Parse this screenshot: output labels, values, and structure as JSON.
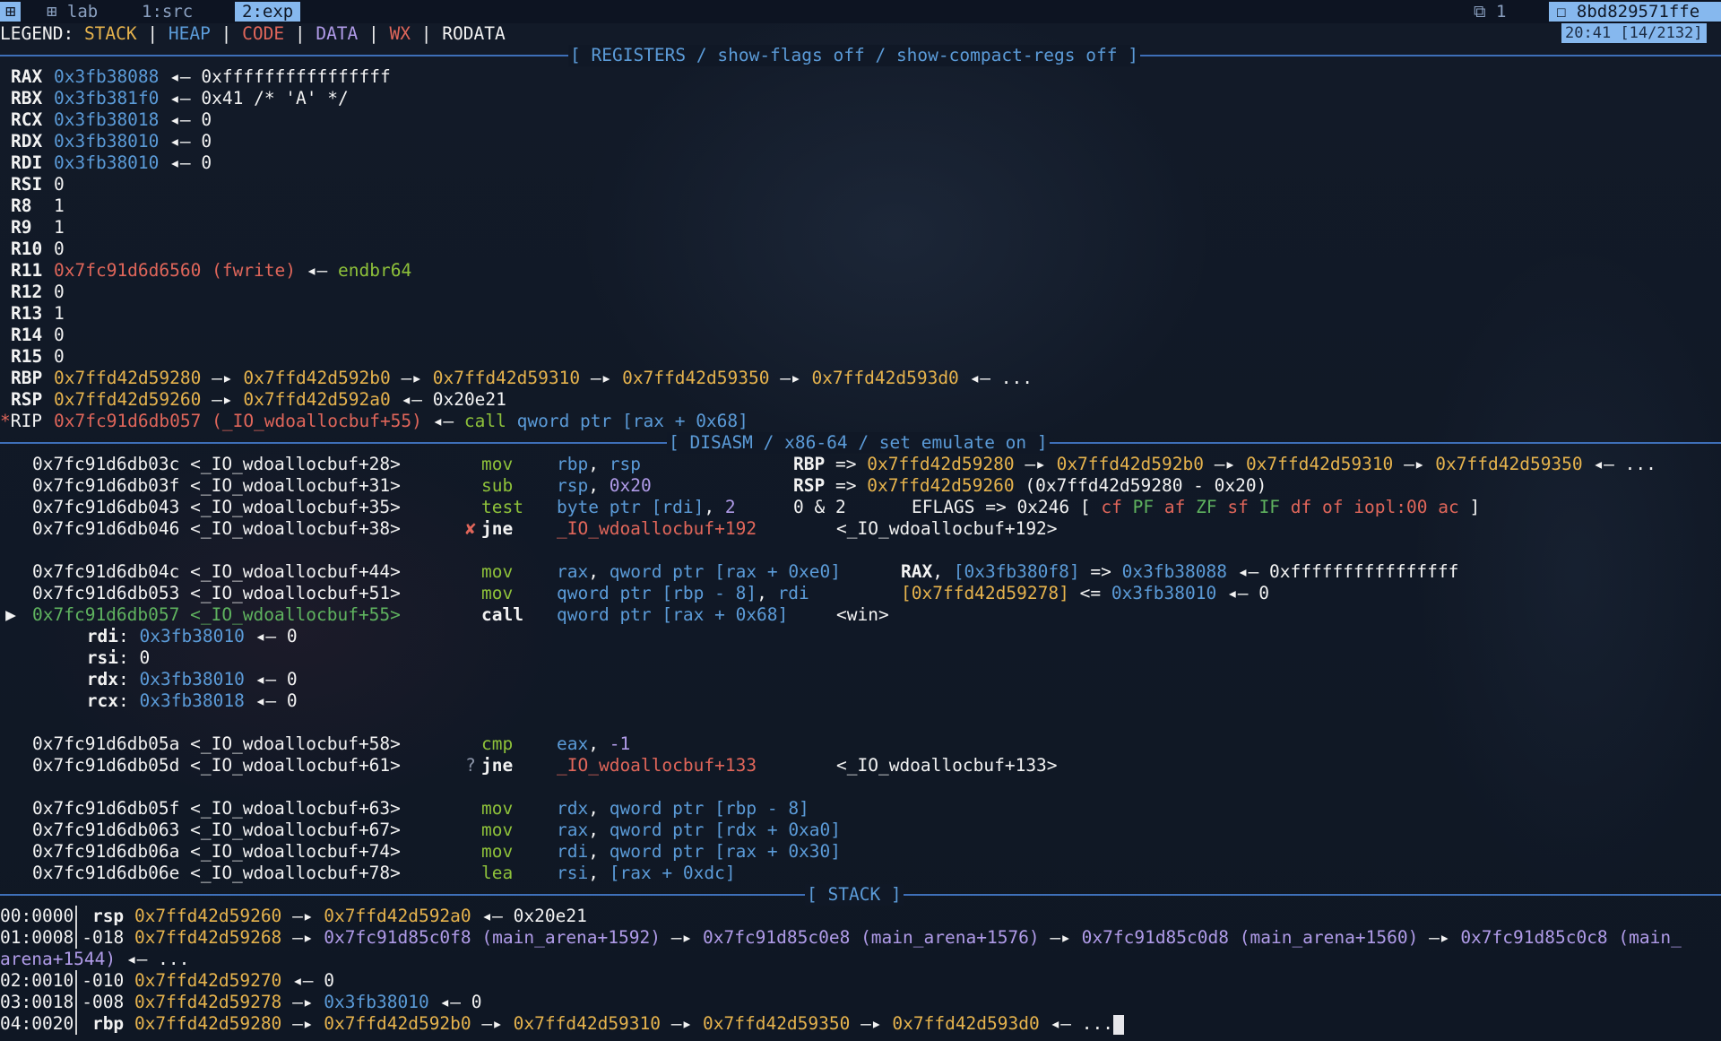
{
  "topbar": {
    "session_icon": "⊞",
    "window_icon": "⊞",
    "tab_lab": "lab",
    "tab_src": "1:src",
    "tab_exp": "2:exp",
    "client_icon": "⧉",
    "client_count": "1",
    "host_icon": "☐",
    "host": "8bd829571ffe",
    "clock": "20:41 [14/2132]"
  },
  "legend": {
    "prefix": "LEGEND:",
    "stack": "STACK",
    "heap": "HEAP",
    "code": "CODE",
    "data": "DATA",
    "wx": "WX",
    "rodata": "RODATA",
    "pipe": "|"
  },
  "headers": {
    "registers": "[ REGISTERS / show-flags off / show-compact-regs off ]",
    "disasm": "[ DISASM / x86-64 / set emulate on ]",
    "stack": "[ STACK ]"
  },
  "registers": {
    "rax": {
      "name": "RAX",
      "a": "0x3fb38088",
      "b": "0xffffffffffffffff"
    },
    "rbx": {
      "name": "RBX",
      "a": "0x3fb381f0",
      "b": "0x41 /* 'A' */"
    },
    "rcx": {
      "name": "RCX",
      "a": "0x3fb38018",
      "b": "0"
    },
    "rdx": {
      "name": "RDX",
      "a": "0x3fb38010",
      "b": "0"
    },
    "rdi": {
      "name": "RDI",
      "a": "0x3fb38010",
      "b": "0"
    },
    "rsi": {
      "name": "RSI",
      "v": "0"
    },
    "r8": {
      "name": "R8",
      "v": "1"
    },
    "r9": {
      "name": "R9",
      "v": "1"
    },
    "r10": {
      "name": "R10",
      "v": "0"
    },
    "r11": {
      "name": "R11",
      "a": "0x7fc91d6d6560 (fwrite)",
      "b": "endbr64"
    },
    "r12": {
      "name": "R12",
      "v": "0"
    },
    "r13": {
      "name": "R13",
      "v": "1"
    },
    "r14": {
      "name": "R14",
      "v": "0"
    },
    "r15": {
      "name": "R15",
      "v": "0"
    },
    "rbp": {
      "name": "RBP",
      "a": "0x7ffd42d59280",
      "b": "0x7ffd42d592b0",
      "c": "0x7ffd42d59310",
      "d": "0x7ffd42d59350",
      "e": "0x7ffd42d593d0",
      "tail": "..."
    },
    "rsp": {
      "name": "RSP",
      "a": "0x7ffd42d59260",
      "b": "0x7ffd42d592a0",
      "c": "0x20e21"
    },
    "rip": {
      "star": "*",
      "name": "RIP",
      "a": "0x7fc91d6db057 (_IO_wdoallocbuf+55)",
      "b": "call",
      "c": "qword ptr [rax + 0x68]"
    }
  },
  "disasm": {
    "l1": {
      "addr": "0x7fc91d6db03c <_IO_wdoallocbuf+28>",
      "mn": "mov",
      "op1": "rbp",
      "op2": "rsp",
      "k": "RBP",
      "v1": "0x7ffd42d59280",
      "v2": "0x7ffd42d592b0",
      "v3": "0x7ffd42d59310",
      "v4": "0x7ffd42d59350",
      "tail": "..."
    },
    "l2": {
      "addr": "0x7fc91d6db03f <_IO_wdoallocbuf+31>",
      "mn": "sub",
      "op1": "rsp",
      "op2": "0x20",
      "k": "RSP",
      "v1": "0x7ffd42d59260",
      "v2": "(0x7ffd42d59280 - 0x20)"
    },
    "l3": {
      "addr": "0x7fc91d6db043 <_IO_wdoallocbuf+35>",
      "mn": "test",
      "op1": "byte ptr [rdi]",
      "op2": "2",
      "c1": "0 & 2",
      "k": "EFLAGS",
      "v1": "0x246",
      "fl_open": "[",
      "fl_cf": "cf",
      "fl_pf": "PF",
      "fl_af": "af",
      "fl_zf": "ZF",
      "fl_sf": "sf",
      "fl_if": "IF",
      "fl_df": "df",
      "fl_of": "of",
      "fl_iopl": "iopl:00",
      "fl_ac": "ac",
      "fl_close": "]"
    },
    "l4": {
      "addr": "0x7fc91d6db046 <_IO_wdoallocbuf+38>",
      "mark": "✘",
      "mn": "jne",
      "op": "_IO_wdoallocbuf+192",
      "target": "<_IO_wdoallocbuf+192>"
    },
    "l5": {
      "addr": "0x7fc91d6db04c <_IO_wdoallocbuf+44>",
      "mn": "mov",
      "op1": "rax",
      "op2": "qword ptr [rax + 0xe0]",
      "k": "RAX",
      "v0": "[0x3fb380f8]",
      "v1": "0x3fb38088",
      "v2": "0xffffffffffffffff"
    },
    "l6": {
      "addr": "0x7fc91d6db053 <_IO_wdoallocbuf+51>",
      "mn": "mov",
      "op1": "qword ptr [rbp - 8]",
      "op2": "rdi",
      "v0": "[0x7ffd42d59278]",
      "v1": "0x3fb38010",
      "v2": "0"
    },
    "l7": {
      "arrow": "▶",
      "addr": "0x7fc91d6db057 <_IO_wdoallocbuf+55>",
      "mn": "call",
      "op": "qword ptr [rax + 0x68]",
      "target": "<win>"
    },
    "args": [
      {
        "name": "rdi",
        "a": "0x3fb38010",
        "b": "0"
      },
      {
        "name": "rsi",
        "v": "0"
      },
      {
        "name": "rdx",
        "a": "0x3fb38010",
        "b": "0"
      },
      {
        "name": "rcx",
        "a": "0x3fb38018",
        "b": "0"
      }
    ],
    "l8": {
      "addr": "0x7fc91d6db05a <_IO_wdoallocbuf+58>",
      "mn": "cmp",
      "op1": "eax",
      "op2": "-1"
    },
    "l9": {
      "addr": "0x7fc91d6db05d <_IO_wdoallocbuf+61>",
      "mark": "?",
      "mn": "jne",
      "op": "_IO_wdoallocbuf+133",
      "target": "<_IO_wdoallocbuf+133>"
    },
    "l10": {
      "addr": "0x7fc91d6db05f <_IO_wdoallocbuf+63>",
      "mn": "mov",
      "op1": "rdx",
      "op2": "qword ptr [rbp - 8]"
    },
    "l11": {
      "addr": "0x7fc91d6db063 <_IO_wdoallocbuf+67>",
      "mn": "mov",
      "op1": "rax",
      "op2": "qword ptr [rdx + 0xa0]"
    },
    "l12": {
      "addr": "0x7fc91d6db06a <_IO_wdoallocbuf+74>",
      "mn": "mov",
      "op1": "rdi",
      "op2": "qword ptr [rax + 0x30]"
    },
    "l13": {
      "addr": "0x7fc91d6db06e <_IO_wdoallocbuf+78>",
      "mn": "lea",
      "op1": "rsi",
      "op2": "[rax + 0xdc]"
    }
  },
  "stack": {
    "s0": {
      "idx": "00:0000",
      "reg": "rsp",
      "a": "0x7ffd42d59260",
      "b": "0x7ffd42d592a0",
      "c": "0x20e21"
    },
    "s1": {
      "idx": "01:0008",
      "reg": "-018",
      "a": "0x7ffd42d59268",
      "b": "0x7fc91d85c0f8 (main_arena+1592)",
      "c": "0x7fc91d85c0e8 (main_arena+1576)",
      "d": "0x7fc91d85c0d8 (main_arena+1560)",
      "e": "0x7fc91d85c0c8 (main_",
      "wrap": "arena+1544)",
      "tail": "..."
    },
    "s2": {
      "idx": "02:0010",
      "reg": "-010",
      "a": "0x7ffd42d59270",
      "b": "0"
    },
    "s3": {
      "idx": "03:0018",
      "reg": "-008",
      "a": "0x7ffd42d59278",
      "b": "0x3fb38010",
      "c": "0"
    },
    "s4": {
      "idx": "04:0020",
      "reg": "rbp",
      "a": "0x7ffd42d59280",
      "b": "0x7ffd42d592b0",
      "c": "0x7ffd42d59310",
      "d": "0x7ffd42d59350",
      "e": "0x7ffd42d593d0",
      "tail": "..."
    }
  },
  "sym": {
    "to": "—▸",
    "back": "◂—",
    "assign": "=>",
    "store": "<=",
    "comma": ","
  }
}
